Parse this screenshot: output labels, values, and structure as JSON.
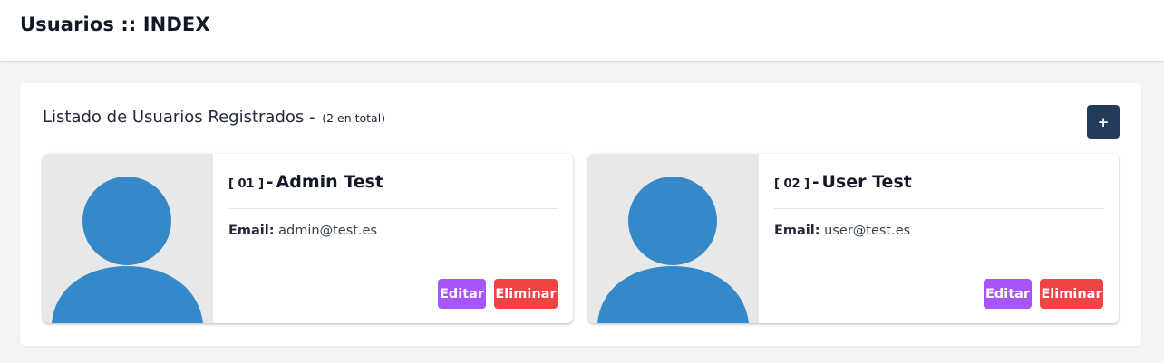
{
  "header": {
    "title": "Usuarios :: INDEX"
  },
  "panel": {
    "title": "Listado de Usuarios Registrados -",
    "count_text": "(2 en total)",
    "add_label": "+"
  },
  "users": [
    {
      "num": "[ 01 ]",
      "dash": "-",
      "name": "Admin Test",
      "email_label": "Email:",
      "email": "admin@test.es",
      "edit_label": "Editar",
      "delete_label": "Eliminar"
    },
    {
      "num": "[ 02 ]",
      "dash": "-",
      "name": "User Test",
      "email_label": "Email:",
      "email": "user@test.es",
      "edit_label": "Editar",
      "delete_label": "Eliminar"
    }
  ],
  "colors": {
    "avatar_fill": "#3589c9",
    "avatar_bg": "#e8e8e8",
    "edit_button": "#a855f7",
    "delete_button": "#ef4444",
    "add_button": "#243b5c"
  },
  "icons": {
    "avatar": "user-silhouette-icon"
  }
}
